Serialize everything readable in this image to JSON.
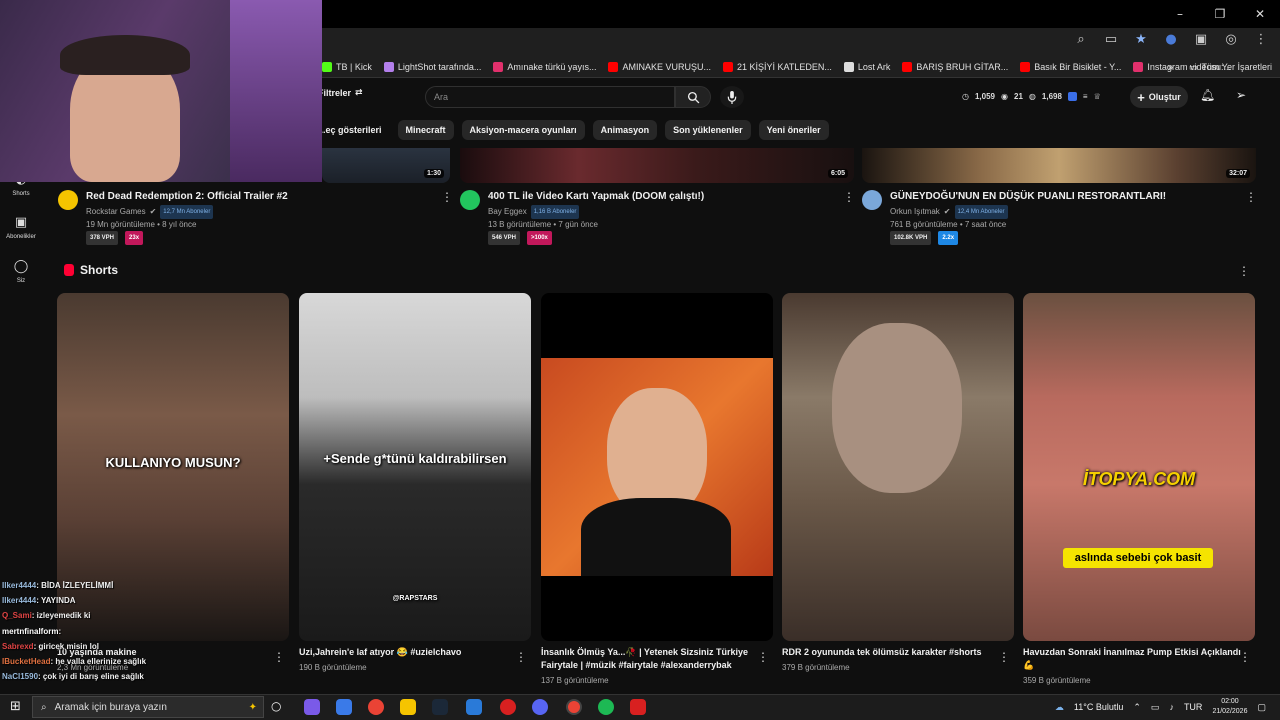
{
  "window": {
    "minimize": "–",
    "maximize": "❐",
    "close": "✕"
  },
  "bookmarks": [
    {
      "label": "TB | Kick",
      "color": "#53fc18"
    },
    {
      "label": "LightShot tarafında...",
      "color": "#b37feb"
    },
    {
      "label": "Amınake türkü yayıs...",
      "color": "#e1306c"
    },
    {
      "label": "AMINAKE VURUŞU...",
      "color": "#ff0000"
    },
    {
      "label": "21 KİŞİYİ KATLEDEN...",
      "color": "#ff0000"
    },
    {
      "label": "Lost Ark",
      "color": "#dddddd"
    },
    {
      "label": "BARIŞ BRUH GİTAR...",
      "color": "#ff0000"
    },
    {
      "label": "Basık Bir Bisiklet - Y...",
      "color": "#ff0000"
    },
    {
      "label": "Instagram videosu:...",
      "color": "#e1306c"
    }
  ],
  "bookmarks_more": "»",
  "all_bookmarks": "Tüm Yer İşaretleri",
  "youtube": {
    "filters_label": "Filtreler",
    "search_placeholder": "Ara",
    "stats": {
      "a": "1,059",
      "b": "21",
      "c": "1,698"
    },
    "create_label": "Oluştur",
    "chips": [
      "Canlı yayın gösterileri",
      "Minecraft",
      "Aksiyon-macera oyunları",
      "Animasyon",
      "Son yüklenenler",
      "Yeni öneriler"
    ],
    "chip0_visible": "...eç gösterileri"
  },
  "sidebar": [
    {
      "label": "Shorts",
      "icon": "shorts-icon"
    },
    {
      "label": "Abonelikler",
      "icon": "subscriptions-icon"
    },
    {
      "label": "Siz",
      "icon": "user-icon"
    }
  ],
  "videos": [
    {
      "title": "Red Dead Redemption 2: Official Trailer #2",
      "channel": "Rockstar Games",
      "subs": "12,7 Mn Aboneler",
      "views": "19 Mn görüntüleme • 8 yıl önce",
      "vph": "378 VPH",
      "ratio": "23x",
      "duration": "1:30",
      "avatar": "#f5c400",
      "ratio_color": "#c2185b"
    },
    {
      "title": "400 TL ile Video Kartı Yapmak (DOOM çalıştı!)",
      "channel": "Bay Eggex",
      "subs": "1,16 B Aboneler",
      "views": "13 B görüntüleme • 7 gün önce",
      "vph": "546 VPH",
      "ratio": ">100x",
      "duration": "6:05",
      "avatar": "#22c55e",
      "ratio_color": "#c2185b"
    },
    {
      "title": "GÜNEYDOĞU'NUN EN DÜŞÜK PUANLI RESTORANTLARI!",
      "channel": "Orkun Işıtmak",
      "subs": "12,4 Mn Aboneler",
      "views": "761 B görüntüleme • 7 saat önce",
      "vph": "102.8K VPH",
      "ratio": "2.2x",
      "duration": "32:07",
      "avatar": "#7aa7d9",
      "ratio_color": "#1e88e5"
    }
  ],
  "shorts_heading": "Shorts",
  "shorts": [
    {
      "title": "10 yaşında makine",
      "views": "2,3 Mn görüntüleme",
      "overlay": "KULLANIYO MUSUN?"
    },
    {
      "title": "Uzi,Jahrein'e laf atıyor 😂 #uzielchavo",
      "views": "190 B görüntüleme",
      "overlay": "+Sende g*tünü kaldırabilirsen",
      "watermark": "@RAPSTARS"
    },
    {
      "title": "İnsanlık Ölmüş Ya...🥀 | Yetenek Sizsiniz Türkiye Fairytale | #müzik #fairytale #alexanderrybak",
      "views": "137 B görüntüleme"
    },
    {
      "title": "RDR 2 oyununda tek ölümsüz karakter #shorts",
      "views": "379 B görüntüleme"
    },
    {
      "title": "Havuzdan Sonraki İnanılmaz Pump Etkisi Açıklandı 💪",
      "views": "359 B görüntüleme",
      "overlay": "aslında sebebi çok basit",
      "brand": "İTOPYA.COM"
    }
  ],
  "chat": [
    {
      "user": "Ilker4444",
      "msg": ": BİDA İZLEYELİMMİ"
    },
    {
      "user": "Ilker4444",
      "msg": ": YAYINDA"
    },
    {
      "user": "Q_Sami",
      "msg": ": izleyemedik ki"
    },
    {
      "user": "mertnfinalform",
      "msg": ":"
    },
    {
      "user": "Sabrexd",
      "msg": ": giricek misin lol"
    },
    {
      "user": "IBucketHead",
      "msg": ": he valla ellerinize sağlık"
    },
    {
      "user": "NaCl1590",
      "msg": ": çok iyi di barış eline sağlık"
    }
  ],
  "taskbar": {
    "search_placeholder": "Aramak için buraya yazın",
    "weather": "11°C  Bulutlu",
    "lang": "TUR",
    "time": "02:00",
    "date": "21/02/2026"
  }
}
